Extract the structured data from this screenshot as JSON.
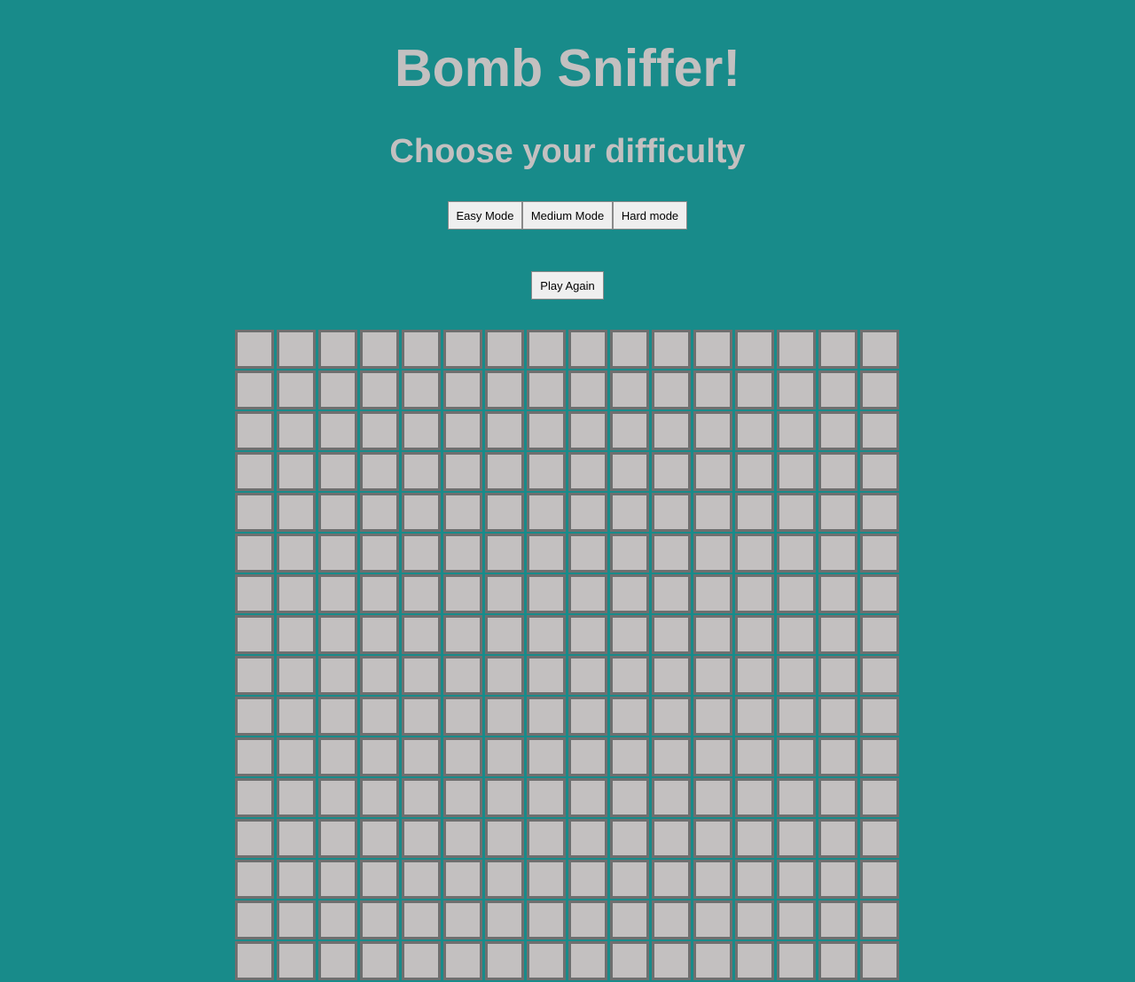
{
  "header": {
    "title": "Bomb Sniffer!",
    "subtitle": "Choose your difficulty"
  },
  "controls": {
    "easy_label": "Easy Mode",
    "medium_label": "Medium Mode",
    "hard_label": "Hard mode",
    "play_again_label": "Play Again"
  },
  "board": {
    "columns": 16,
    "rows_visible": 16,
    "cell_state": "hidden"
  },
  "colors": {
    "background": "#188b8a",
    "heading_text": "#c3c0c0",
    "cell_fill": "#c3c0c0",
    "cell_border": "#6f6f6f",
    "button_fill": "#efefef"
  }
}
